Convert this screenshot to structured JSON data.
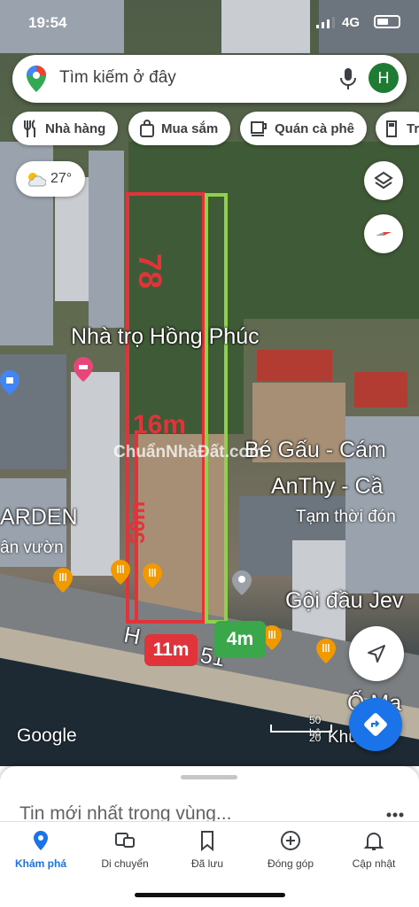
{
  "status_bar": {
    "time": "19:54",
    "network": "4G"
  },
  "search": {
    "placeholder": "Tìm kiếm ở đây",
    "avatar_letter": "H"
  },
  "chips": [
    {
      "label": "Nhà hàng",
      "icon": "fork-knife-icon"
    },
    {
      "label": "Mua sắm",
      "icon": "shopping-bag-icon"
    },
    {
      "label": "Quán cà phê",
      "icon": "coffee-cup-icon"
    },
    {
      "label": "Tr",
      "icon": "gas-pump-icon"
    }
  ],
  "weather": {
    "temp": "27°",
    "icon": "partly-cloudy-icon"
  },
  "overlay": {
    "length_label": "78",
    "width_red_label": "16m",
    "side_label": "50m",
    "front_red_label": "11m",
    "front_green_label": "4m",
    "red_color": "#e0343a",
    "green_color": "#8fd14a"
  },
  "map_labels": {
    "nha_tro": "Nhà trọ Hồng Phúc",
    "be_gau": "Bé Gấu - Cám",
    "anthy": "AnThy - Cầ",
    "tam_thoi": "Tạm thời đón",
    "garden": "ARDEN",
    "vuon": "ân vườn",
    "goi_dau": "Gội đầu Jev",
    "road": "H",
    "road2": "51",
    "om": "Ố  Ma",
    "khu": "Khu",
    "watermark": "ChuẩnNhàĐất.com"
  },
  "google": "Google",
  "scale": {
    "top": "50 bộ",
    "bottom": "20"
  },
  "sheet": {
    "title": "Tin mới nhất trong vùng..."
  },
  "nav": [
    {
      "label": "Khám phá",
      "icon": "location-pin-icon",
      "active": true
    },
    {
      "label": "Di chuyển",
      "icon": "commute-icon",
      "active": false
    },
    {
      "label": "Đã lưu",
      "icon": "bookmark-icon",
      "active": false
    },
    {
      "label": "Đóng góp",
      "icon": "add-circle-icon",
      "active": false
    },
    {
      "label": "Cập nhật",
      "icon": "bell-icon",
      "active": false
    }
  ]
}
